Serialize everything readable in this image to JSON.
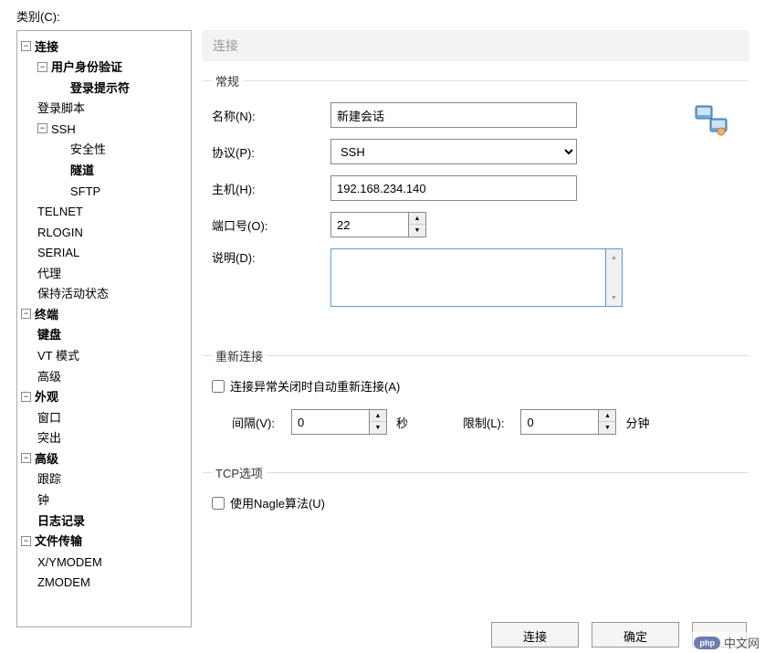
{
  "category_label": "类别(C):",
  "tree": {
    "connection": "连接",
    "user_auth": "用户身份验证",
    "login_prompt": "登录提示符",
    "login_script": "登录脚本",
    "ssh": "SSH",
    "security": "安全性",
    "tunnel": "隧道",
    "sftp": "SFTP",
    "telnet": "TELNET",
    "rlogin": "RLOGIN",
    "serial": "SERIAL",
    "proxy": "代理",
    "keepalive": "保持活动状态",
    "terminal": "终端",
    "keyboard": "键盘",
    "vt_mode": "VT 模式",
    "advanced_term": "高级",
    "appearance": "外观",
    "window": "窗口",
    "highlight": "突出",
    "advanced": "高级",
    "trace": "跟踪",
    "bell": "钟",
    "logging": "日志记录",
    "file_transfer": "文件传输",
    "xymodem": "X/YMODEM",
    "zmodem": "ZMODEM"
  },
  "panel_title": "连接",
  "general": {
    "legend": "常规",
    "name_label": "名称(N):",
    "name_value": "新建会话",
    "protocol_label": "协议(P):",
    "protocol_value": "SSH",
    "host_label": "主机(H):",
    "host_value": "192.168.234.140",
    "port_label": "端口号(O):",
    "port_value": "22",
    "desc_label": "说明(D):",
    "desc_value": ""
  },
  "reconnect": {
    "legend": "重新连接",
    "checkbox_label": "连接异常关闭时自动重新连接(A)",
    "interval_label": "间隔(V):",
    "interval_value": "0",
    "interval_unit": "秒",
    "limit_label": "限制(L):",
    "limit_value": "0",
    "limit_unit": "分钟"
  },
  "tcp": {
    "legend": "TCP选项",
    "nagle_label": "使用Nagle算法(U)"
  },
  "buttons": {
    "connect": "连接",
    "ok": "确定"
  },
  "watermark": "中文网",
  "watermark_badge": "php"
}
